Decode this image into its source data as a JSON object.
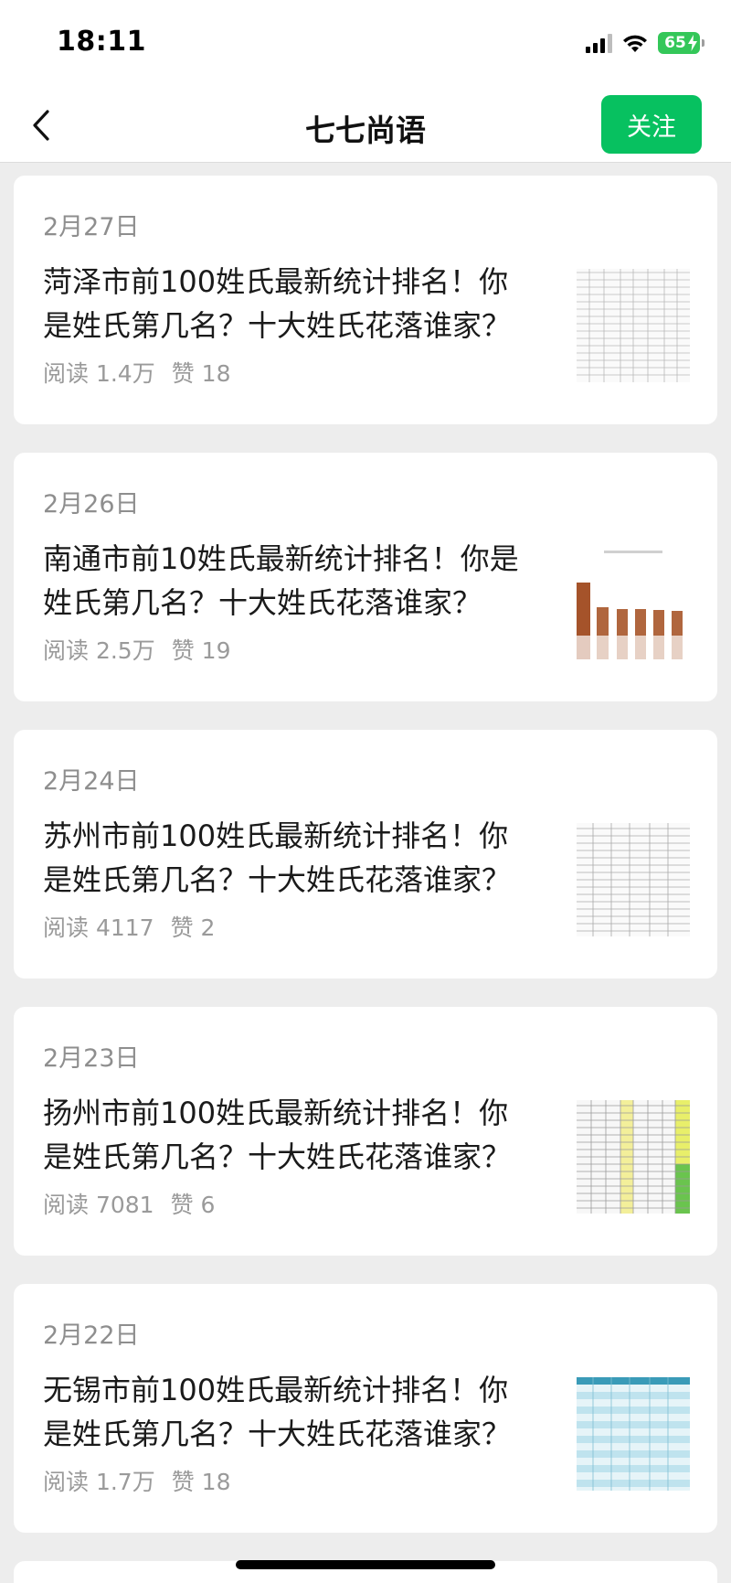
{
  "status_bar": {
    "time": "18:11",
    "battery": "65"
  },
  "nav": {
    "title": "七七尚语",
    "follow_label": "关注"
  },
  "articles": [
    {
      "date": "2月27日",
      "title": "菏泽市前100姓氏最新统计排名！你是姓氏第几名？十大姓氏花落谁家？",
      "reads": "阅读 1.4万",
      "likes": "赞 18",
      "thumb": "table-thumbnail"
    },
    {
      "date": "2月26日",
      "title": "南通市前10姓氏最新统计排名！你是姓氏第几名？十大姓氏花落谁家？",
      "reads": "阅读 2.5万",
      "likes": "赞 19",
      "thumb": "bar-chart-thumbnail"
    },
    {
      "date": "2月24日",
      "title": "苏州市前100姓氏最新统计排名！你是姓氏第几名？十大姓氏花落谁家？",
      "reads": "阅读 4117",
      "likes": "赞 2",
      "thumb": "table-thumbnail"
    },
    {
      "date": "2月23日",
      "title": "扬州市前100姓氏最新统计排名！你是姓氏第几名？十大姓氏花落谁家？",
      "reads": "阅读 7081",
      "likes": "赞 6",
      "thumb": "colored-table-thumbnail"
    },
    {
      "date": "2月22日",
      "title": "无锡市前100姓氏最新统计排名！你是姓氏第几名？十大姓氏花落谁家？",
      "reads": "阅读 1.7万",
      "likes": "赞 18",
      "thumb": "blue-table-thumbnail"
    }
  ],
  "colors": {
    "accent": "#07c160",
    "background": "#ededed"
  }
}
